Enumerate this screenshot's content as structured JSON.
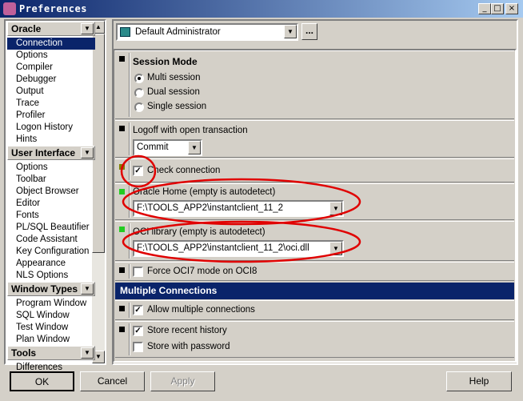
{
  "window": {
    "title": "Preferences",
    "min": "_",
    "max": "□",
    "close": "×"
  },
  "sidebar": {
    "groups": [
      {
        "label": "Oracle",
        "items": [
          "Connection",
          "Options",
          "Compiler",
          "Debugger",
          "Output",
          "Trace",
          "Profiler",
          "Logon History",
          "Hints"
        ]
      },
      {
        "label": "User Interface",
        "items": [
          "Options",
          "Toolbar",
          "Object Browser",
          "Editor",
          "Fonts",
          "PL/SQL Beautifier",
          "Code Assistant",
          "Key Configuration",
          "Appearance",
          "NLS Options"
        ]
      },
      {
        "label": "Window Types",
        "items": [
          "Program Window",
          "SQL Window",
          "Test Window",
          "Plan Window"
        ]
      },
      {
        "label": "Tools",
        "items": [
          "Differences"
        ]
      }
    ],
    "selected": "Connection"
  },
  "profile": {
    "value": "Default Administrator",
    "more": "..."
  },
  "session": {
    "title": "Session Mode",
    "options": [
      "Multi session",
      "Dual session",
      "Single session"
    ],
    "selected": "Multi session"
  },
  "logoff": {
    "label": "Logoff with open transaction",
    "value": "Commit"
  },
  "check_connection": {
    "label": "Check connection",
    "checked": true
  },
  "oracle_home": {
    "label": "Oracle Home (empty is autodetect)",
    "value": "F:\\TOOLS_APP2\\instantclient_11_2"
  },
  "oci_library": {
    "label": "OCI library (empty is autodetect)",
    "value": "F:\\TOOLS_APP2\\instantclient_11_2\\oci.dll"
  },
  "force_oci7": {
    "label": "Force OCI7 mode on OCI8",
    "checked": false
  },
  "multiple": {
    "header": "Multiple Connections",
    "allow": {
      "label": "Allow multiple connections",
      "checked": true
    },
    "history": {
      "label": "Store recent history",
      "checked": true
    },
    "password": {
      "label": "Store with password",
      "checked": false
    }
  },
  "buttons": {
    "ok": "OK",
    "cancel": "Cancel",
    "apply": "Apply",
    "help": "Help"
  },
  "colors": {
    "title_bar": "#0a246a",
    "selection": "#0a246a",
    "annotation": "#e00000",
    "modified_marker": "#22cc22"
  }
}
